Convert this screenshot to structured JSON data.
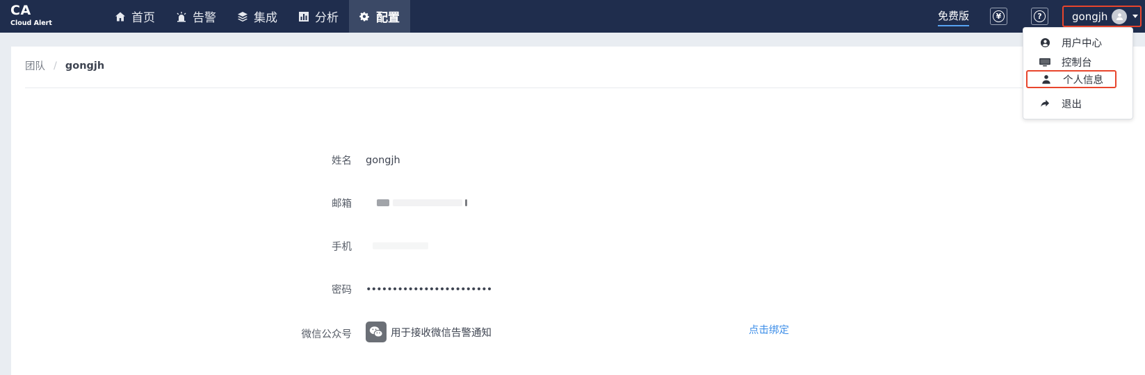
{
  "logo": {
    "title": "CA",
    "subtitle": "Cloud Alert"
  },
  "nav": [
    {
      "label": "首页",
      "icon": "home-icon"
    },
    {
      "label": "告警",
      "icon": "alarm-icon"
    },
    {
      "label": "集成",
      "icon": "layers-icon"
    },
    {
      "label": "分析",
      "icon": "bar-chart-icon"
    },
    {
      "label": "配置",
      "icon": "gears-icon",
      "active": true
    }
  ],
  "header": {
    "plan_label": "免费版",
    "billing_icon_glyph": "¥",
    "help_icon_glyph": "?",
    "username": "gongjh"
  },
  "breadcrumb": {
    "parent": "团队",
    "separator": "/",
    "current": "gongjh"
  },
  "profile": {
    "name_label": "姓名",
    "name_value": "gongjh",
    "email_label": "邮箱",
    "phone_label": "手机",
    "password_label": "密码",
    "password_value": "••••••••••••••••••••••••",
    "wechat_label": "微信公众号",
    "wechat_desc": "用于接收微信告警通知",
    "bind_label": "点击绑定"
  },
  "user_menu": {
    "items": [
      {
        "label": "用户中心",
        "icon": "user-circle-icon"
      },
      {
        "label": "控制台",
        "icon": "monitor-icon"
      },
      {
        "label": "个人信息",
        "icon": "user-icon",
        "highlighted": true
      },
      {
        "label": "退出",
        "icon": "share-arrow-icon"
      }
    ]
  },
  "colors": {
    "topbar": "#1f2d4d",
    "nav_active": "#3b4966",
    "highlight_border": "#e8452c",
    "link": "#3d8ee8"
  }
}
